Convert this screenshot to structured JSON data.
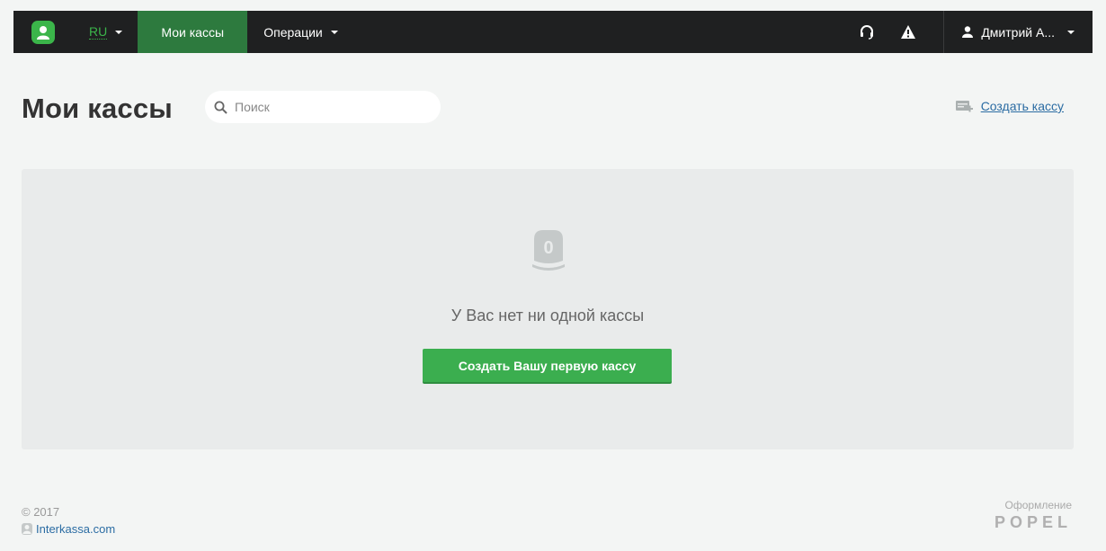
{
  "nav": {
    "lang": "RU",
    "active_item": "Мои кассы",
    "operations": "Операции",
    "user": "Дмитрий А..."
  },
  "header": {
    "title": "Мои кассы",
    "search_placeholder": "Поиск",
    "create_link": "Создать кассу"
  },
  "empty_state": {
    "icon_number": "0",
    "message": "У Вас нет ни одной кассы",
    "button": "Создать Вашу первую кассу"
  },
  "footer": {
    "copyright": "© 2017",
    "site_link": "Interkassa.com",
    "design_label": "Оформление",
    "design_brand": "POPEL"
  },
  "colors": {
    "topbar": "#1f2021",
    "accent_green": "#3bb54a",
    "active_tab": "#2d7a3e",
    "link_blue": "#2b6ca3",
    "background": "#f3f5f4",
    "panel": "#e9ebeb"
  },
  "icons": [
    "logo-icon",
    "chevron-down-icon",
    "headset-icon",
    "warning-icon",
    "user-icon",
    "search-icon",
    "add-register-icon",
    "empty-register-icon",
    "interkassa-icon"
  ]
}
